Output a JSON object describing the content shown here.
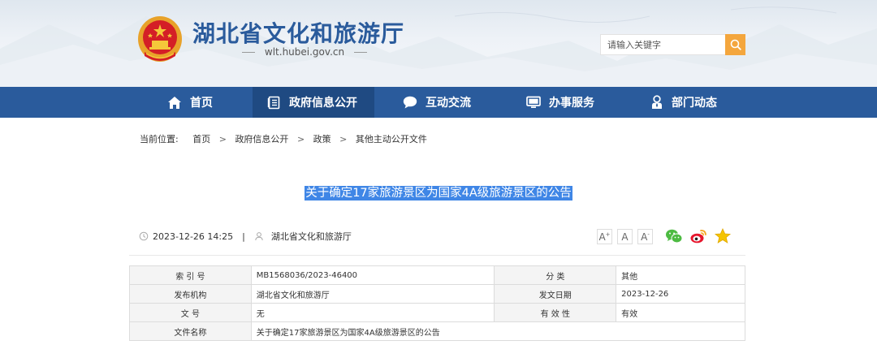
{
  "header": {
    "site_title": "湖北省文化和旅游厅",
    "site_domain": "wlt.hubei.gov.cn",
    "search_placeholder": "请输入关键字"
  },
  "nav": {
    "items": [
      {
        "label": "首页",
        "icon": "home-icon"
      },
      {
        "label": "政府信息公开",
        "icon": "document-icon"
      },
      {
        "label": "互动交流",
        "icon": "chat-bubble-icon"
      },
      {
        "label": "办事服务",
        "icon": "monitor-icon"
      },
      {
        "label": "部门动态",
        "icon": "person-icon"
      }
    ],
    "active_index": 1
  },
  "breadcrumb": {
    "lead": "当前位置:",
    "items": [
      "首页",
      "政府信息公开",
      "政策",
      "其他主动公开文件"
    ],
    "separator": ">"
  },
  "article": {
    "title": "关于确定17家旅游景区为国家4A级旅游景区的公告",
    "datetime": "2023-12-26 14:25",
    "divider": "|",
    "source": "湖北省文化和旅游厅",
    "font_size_buttons": [
      "A+",
      "A",
      "A-"
    ],
    "share_icons": [
      "wechat-icon",
      "weibo-icon",
      "star-icon"
    ]
  },
  "info_table": {
    "rows": [
      [
        {
          "label": "索 引 号",
          "value": "MB1568036/2023-46400"
        },
        {
          "label": "分 类",
          "value": "其他"
        }
      ],
      [
        {
          "label": "发布机构",
          "value": "湖北省文化和旅游厅"
        },
        {
          "label": "发文日期",
          "value": "2023-12-26"
        }
      ],
      [
        {
          "label": "文 号",
          "value": "无"
        },
        {
          "label": "有 效 性",
          "value": "有效"
        }
      ],
      [
        {
          "label": "文件名称",
          "value": "关于确定17家旅游景区为国家4A级旅游景区的公告"
        }
      ]
    ]
  },
  "colors": {
    "brand_blue": "#2a5b9c",
    "search_orange": "#f4a63d",
    "selection_blue": "#3f86e6"
  }
}
